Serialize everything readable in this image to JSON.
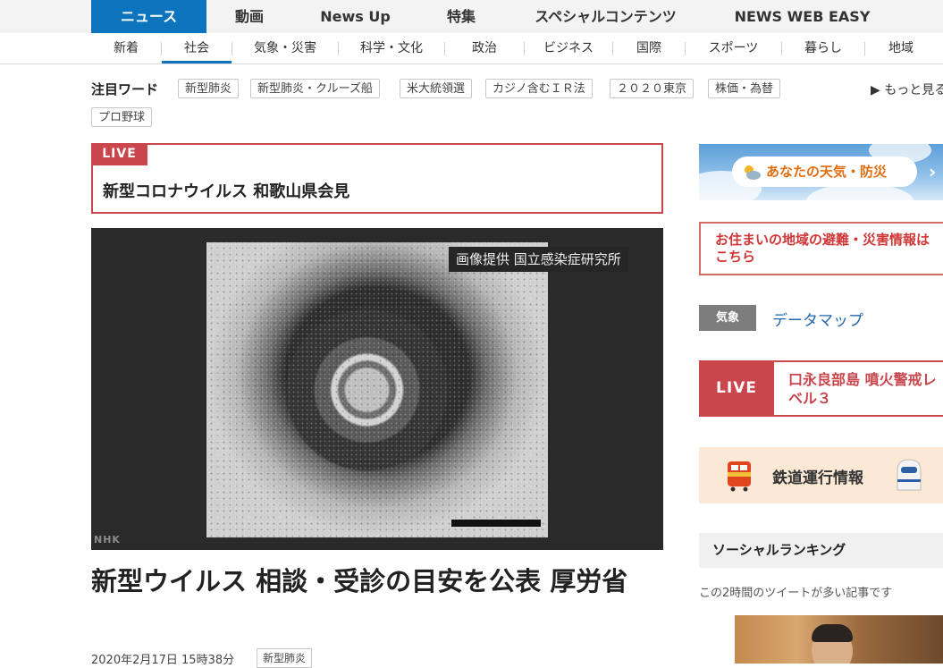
{
  "topnav": {
    "tabs": [
      "ニュース",
      "動画",
      "News Up",
      "特集",
      "スペシャルコンテンツ",
      "NEWS WEB EASY"
    ],
    "active_tab": "ニュース"
  },
  "subnav": {
    "items": [
      "新着",
      "社会",
      "気象・災害",
      "科学・文化",
      "政治",
      "ビジネス",
      "国際",
      "スポーツ",
      "暮らし",
      "地域"
    ],
    "active_item": "社会"
  },
  "attention": {
    "label": "注目ワード",
    "words": [
      "新型肺炎",
      "新型肺炎・クルーズ船",
      "米大統領選",
      "カジノ含むＩＲ法",
      "２０２０東京",
      "株価・為替",
      "プロ野球"
    ],
    "more_link": "▶ もっと見る"
  },
  "live_banner": {
    "tag": "LIVE",
    "title": "新型コロナウイルス 和歌山県会見"
  },
  "hero": {
    "caption": "画像提供 国立感染症研究所",
    "logo": "NHK"
  },
  "article": {
    "title": "新型ウイルス 相談・受診の目安を公表 厚労省",
    "date": "2020年2月17日 15時38分",
    "tag": "新型肺炎"
  },
  "sidebar": {
    "weather_banner": "あなたの天気・防災",
    "evacuation_info": "お住まいの地域の避難・災害情報はこちら",
    "kisho_tag": "気象",
    "datamap_link": "データマップ",
    "live_tag": "LIVE",
    "live_text": "口永良部島 噴火警戒レベル３",
    "rail_info": "鉄道運行情報",
    "social_heading": "ソーシャルランキング",
    "social_subtext": "この2時間のツイートが多い記事です"
  },
  "colors": {
    "brand_blue": "#0c74bd",
    "live_red": "#c9464c",
    "weather_orange": "#e06d12",
    "link_blue": "#1f67b0"
  }
}
